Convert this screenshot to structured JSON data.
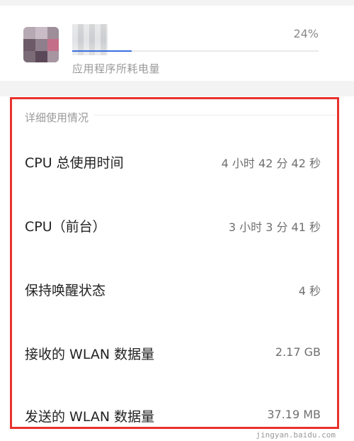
{
  "app": {
    "percent": "24%",
    "usage_fraction": 0.24,
    "subtitle": "应用程序所耗电量"
  },
  "details": {
    "header": "详细使用情况",
    "rows": [
      {
        "label": "CPU 总使用时间",
        "value": "4 小时 42 分 42 秒"
      },
      {
        "label": "CPU（前台）",
        "value": "3 小时 3 分 41 秒"
      },
      {
        "label": "保持唤醒状态",
        "value": "4 秒"
      },
      {
        "label": "接收的 WLAN 数据量",
        "value": "2.17 GB"
      },
      {
        "label": "发送的 WLAN 数据量",
        "value": "37.19 MB"
      }
    ]
  },
  "watermark": "jingyan.baidu.com",
  "colors": {
    "accent": "#3a6fe0",
    "highlight_border": "#e8322f",
    "secondary_text": "#9a9a9a"
  }
}
